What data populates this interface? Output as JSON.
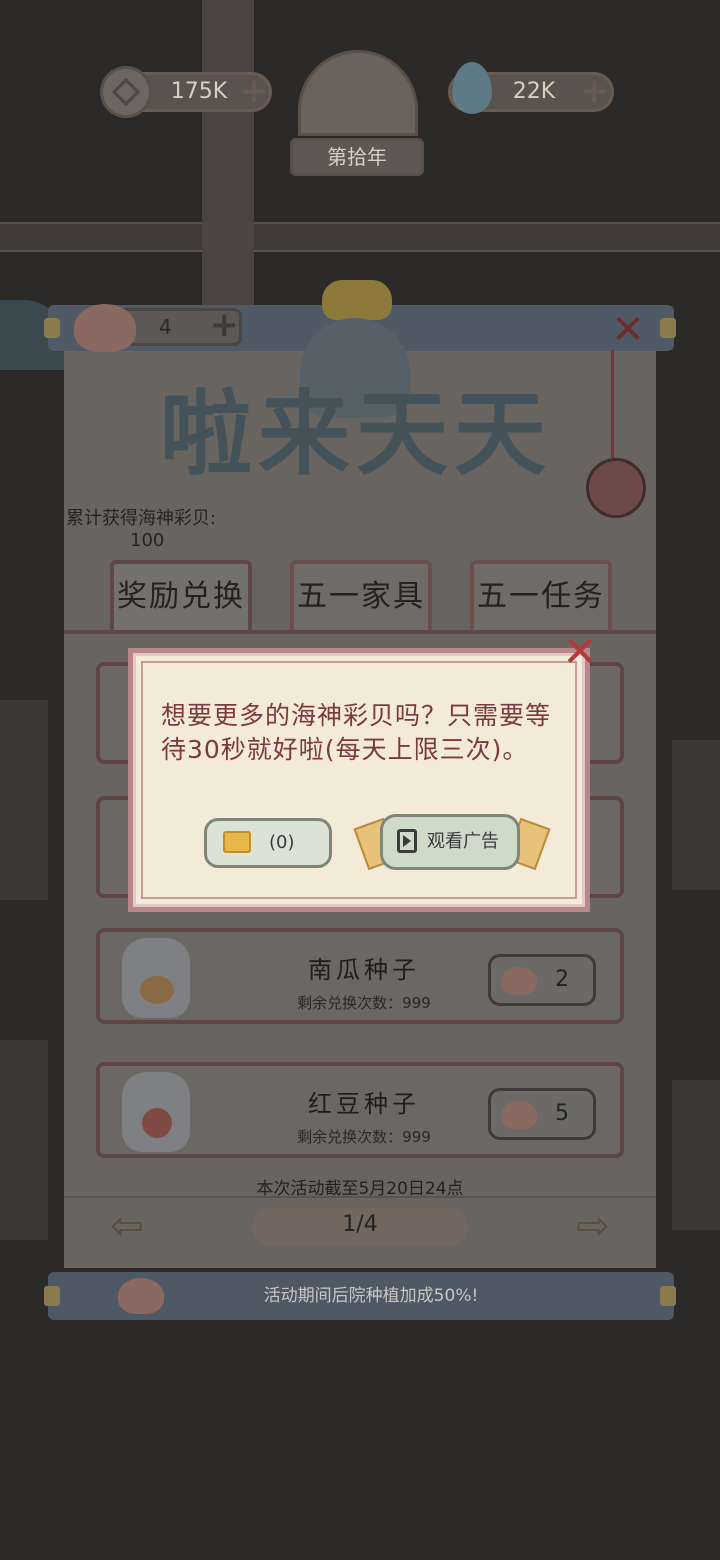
{
  "hud": {
    "coins": "175K",
    "spirit": "22K",
    "year": "第拾年"
  },
  "panel": {
    "shell_count": "4",
    "title": "啦来天天",
    "cumulative_label": "累计获得海神彩贝:",
    "cumulative_value": "100",
    "tabs": [
      {
        "label": "奖励兑换"
      },
      {
        "label": "五一家具"
      },
      {
        "label": "五一任务"
      }
    ],
    "items": [
      {
        "name": "南瓜种子",
        "remaining": "剩余兑换次数：999",
        "price": "2"
      },
      {
        "name": "红豆种子",
        "remaining": "剩余兑换次数：999",
        "price": "5"
      }
    ],
    "end_note": "本次活动截至5月20日24点",
    "page": "1/4",
    "bonus_banner": "活动期间后院种植加成50%!"
  },
  "dialog": {
    "message": "想要更多的海神彩贝吗？只需要等待30秒就好啦(每天上限三次)。",
    "ticket_button": "(0)",
    "ad_button": "观看广告"
  },
  "colors": {
    "dialog_text": "#7b3b3a",
    "dialog_border": "#b9868a",
    "close_red": "#b23a3a"
  }
}
